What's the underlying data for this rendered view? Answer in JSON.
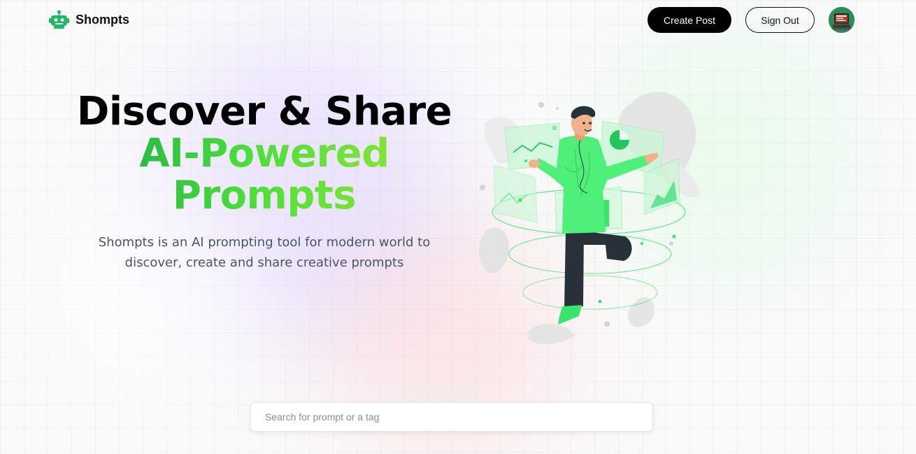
{
  "brand": {
    "name": "Shompts",
    "logo_icon": "robot-icon",
    "accent": "#16a34a"
  },
  "nav": {
    "create_post_label": "Create Post",
    "sign_out_label": "Sign Out",
    "avatar_icon": "user-avatar"
  },
  "hero": {
    "title_line_1": "Discover & Share",
    "title_line_2": "AI-Powered",
    "title_line_3": "Prompts",
    "subtitle": "Shompts is an AI prompting tool for modern world to discover, create and share creative prompts",
    "gradient_colors": [
      "#16a34a",
      "#4ade3a",
      "#a3e635"
    ]
  },
  "search": {
    "value": "",
    "placeholder": "Search for prompt or a tag"
  }
}
